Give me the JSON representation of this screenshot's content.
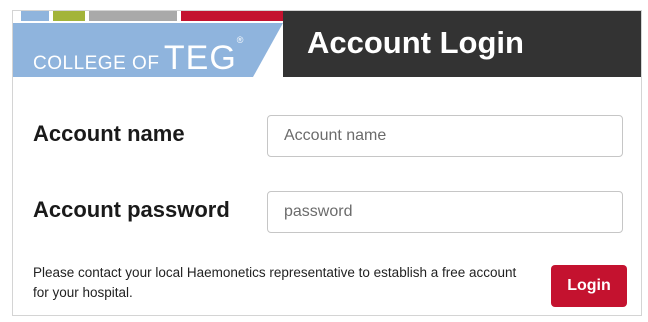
{
  "colors": {
    "stripe_blue": "#8fb4dd",
    "stripe_green": "#a3b43a",
    "stripe_gray": "#a9a9a9",
    "stripe_red": "#c4122f",
    "logo_blue": "#8fb4dd",
    "title_bar": "#333333",
    "login_button": "#c4122f"
  },
  "logo": {
    "prefix": "COLLEGE OF",
    "brand": "TEG",
    "reg_mark": "®"
  },
  "header": {
    "title": "Account Login"
  },
  "form": {
    "account_name": {
      "label": "Account name",
      "placeholder": "Account name",
      "value": ""
    },
    "account_password": {
      "label": "Account password",
      "placeholder": "password",
      "value": ""
    }
  },
  "footer": {
    "notice": "Please contact your local Haemonetics representative to establish a free account for your hospital.",
    "login_label": "Login"
  }
}
